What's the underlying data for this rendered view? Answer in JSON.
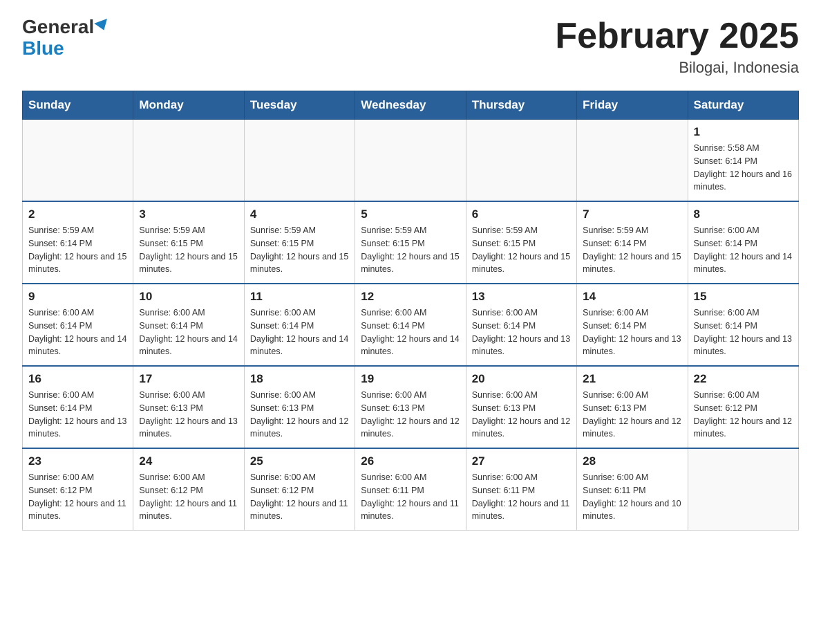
{
  "header": {
    "logo_line1": "General",
    "logo_line2": "Blue",
    "month_title": "February 2025",
    "subtitle": "Bilogai, Indonesia"
  },
  "weekdays": [
    "Sunday",
    "Monday",
    "Tuesday",
    "Wednesday",
    "Thursday",
    "Friday",
    "Saturday"
  ],
  "weeks": [
    [
      {
        "day": "",
        "info": ""
      },
      {
        "day": "",
        "info": ""
      },
      {
        "day": "",
        "info": ""
      },
      {
        "day": "",
        "info": ""
      },
      {
        "day": "",
        "info": ""
      },
      {
        "day": "",
        "info": ""
      },
      {
        "day": "1",
        "info": "Sunrise: 5:58 AM\nSunset: 6:14 PM\nDaylight: 12 hours and 16 minutes."
      }
    ],
    [
      {
        "day": "2",
        "info": "Sunrise: 5:59 AM\nSunset: 6:14 PM\nDaylight: 12 hours and 15 minutes."
      },
      {
        "day": "3",
        "info": "Sunrise: 5:59 AM\nSunset: 6:15 PM\nDaylight: 12 hours and 15 minutes."
      },
      {
        "day": "4",
        "info": "Sunrise: 5:59 AM\nSunset: 6:15 PM\nDaylight: 12 hours and 15 minutes."
      },
      {
        "day": "5",
        "info": "Sunrise: 5:59 AM\nSunset: 6:15 PM\nDaylight: 12 hours and 15 minutes."
      },
      {
        "day": "6",
        "info": "Sunrise: 5:59 AM\nSunset: 6:15 PM\nDaylight: 12 hours and 15 minutes."
      },
      {
        "day": "7",
        "info": "Sunrise: 5:59 AM\nSunset: 6:14 PM\nDaylight: 12 hours and 15 minutes."
      },
      {
        "day": "8",
        "info": "Sunrise: 6:00 AM\nSunset: 6:14 PM\nDaylight: 12 hours and 14 minutes."
      }
    ],
    [
      {
        "day": "9",
        "info": "Sunrise: 6:00 AM\nSunset: 6:14 PM\nDaylight: 12 hours and 14 minutes."
      },
      {
        "day": "10",
        "info": "Sunrise: 6:00 AM\nSunset: 6:14 PM\nDaylight: 12 hours and 14 minutes."
      },
      {
        "day": "11",
        "info": "Sunrise: 6:00 AM\nSunset: 6:14 PM\nDaylight: 12 hours and 14 minutes."
      },
      {
        "day": "12",
        "info": "Sunrise: 6:00 AM\nSunset: 6:14 PM\nDaylight: 12 hours and 14 minutes."
      },
      {
        "day": "13",
        "info": "Sunrise: 6:00 AM\nSunset: 6:14 PM\nDaylight: 12 hours and 13 minutes."
      },
      {
        "day": "14",
        "info": "Sunrise: 6:00 AM\nSunset: 6:14 PM\nDaylight: 12 hours and 13 minutes."
      },
      {
        "day": "15",
        "info": "Sunrise: 6:00 AM\nSunset: 6:14 PM\nDaylight: 12 hours and 13 minutes."
      }
    ],
    [
      {
        "day": "16",
        "info": "Sunrise: 6:00 AM\nSunset: 6:14 PM\nDaylight: 12 hours and 13 minutes."
      },
      {
        "day": "17",
        "info": "Sunrise: 6:00 AM\nSunset: 6:13 PM\nDaylight: 12 hours and 13 minutes."
      },
      {
        "day": "18",
        "info": "Sunrise: 6:00 AM\nSunset: 6:13 PM\nDaylight: 12 hours and 12 minutes."
      },
      {
        "day": "19",
        "info": "Sunrise: 6:00 AM\nSunset: 6:13 PM\nDaylight: 12 hours and 12 minutes."
      },
      {
        "day": "20",
        "info": "Sunrise: 6:00 AM\nSunset: 6:13 PM\nDaylight: 12 hours and 12 minutes."
      },
      {
        "day": "21",
        "info": "Sunrise: 6:00 AM\nSunset: 6:13 PM\nDaylight: 12 hours and 12 minutes."
      },
      {
        "day": "22",
        "info": "Sunrise: 6:00 AM\nSunset: 6:12 PM\nDaylight: 12 hours and 12 minutes."
      }
    ],
    [
      {
        "day": "23",
        "info": "Sunrise: 6:00 AM\nSunset: 6:12 PM\nDaylight: 12 hours and 11 minutes."
      },
      {
        "day": "24",
        "info": "Sunrise: 6:00 AM\nSunset: 6:12 PM\nDaylight: 12 hours and 11 minutes."
      },
      {
        "day": "25",
        "info": "Sunrise: 6:00 AM\nSunset: 6:12 PM\nDaylight: 12 hours and 11 minutes."
      },
      {
        "day": "26",
        "info": "Sunrise: 6:00 AM\nSunset: 6:11 PM\nDaylight: 12 hours and 11 minutes."
      },
      {
        "day": "27",
        "info": "Sunrise: 6:00 AM\nSunset: 6:11 PM\nDaylight: 12 hours and 11 minutes."
      },
      {
        "day": "28",
        "info": "Sunrise: 6:00 AM\nSunset: 6:11 PM\nDaylight: 12 hours and 10 minutes."
      },
      {
        "day": "",
        "info": ""
      }
    ]
  ]
}
